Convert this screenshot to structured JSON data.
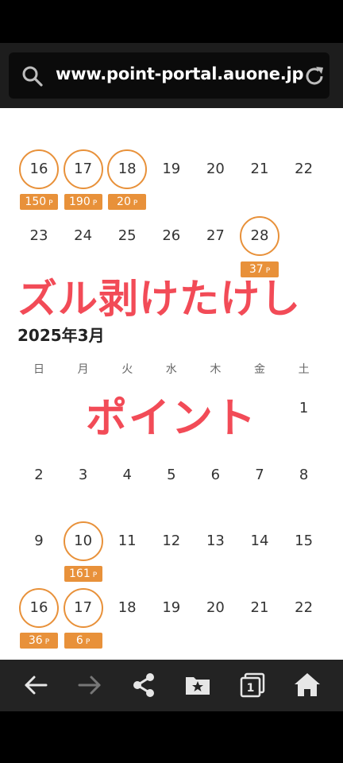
{
  "browser": {
    "url": "www.point-portal.auone.jp"
  },
  "calendar_feb": {
    "rows": [
      [
        {
          "day": "16",
          "points": "150",
          "unit": "P",
          "circled": true
        },
        {
          "day": "17",
          "points": "190",
          "unit": "P",
          "circled": true
        },
        {
          "day": "18",
          "points": "20",
          "unit": "P",
          "circled": true
        },
        {
          "day": "19"
        },
        {
          "day": "20"
        },
        {
          "day": "21"
        },
        {
          "day": "22"
        }
      ],
      [
        {
          "day": "23"
        },
        {
          "day": "24"
        },
        {
          "day": "25"
        },
        {
          "day": "26"
        },
        {
          "day": "27"
        },
        {
          "day": "28",
          "points": "37",
          "unit": "P",
          "circled": true
        }
      ]
    ]
  },
  "overlay_text": {
    "headline": "ズル剥けたけし",
    "subline": "ポイント"
  },
  "calendar_mar": {
    "title": "2025年3月",
    "weekdays": [
      "日",
      "月",
      "火",
      "水",
      "木",
      "金",
      "土"
    ],
    "rows": [
      [
        {
          "day": "1"
        }
      ],
      [
        {
          "day": "2"
        },
        {
          "day": "3"
        },
        {
          "day": "4"
        },
        {
          "day": "5"
        },
        {
          "day": "6"
        },
        {
          "day": "7"
        },
        {
          "day": "8"
        }
      ],
      [
        {
          "day": "9"
        },
        {
          "day": "10",
          "points": "161",
          "unit": "P",
          "circled": true
        },
        {
          "day": "11"
        },
        {
          "day": "12"
        },
        {
          "day": "13"
        },
        {
          "day": "14"
        },
        {
          "day": "15"
        }
      ],
      [
        {
          "day": "16",
          "points": "36",
          "unit": "P",
          "circled": true
        },
        {
          "day": "17",
          "points": "6",
          "unit": "P",
          "circled": true
        },
        {
          "day": "18"
        },
        {
          "day": "19"
        },
        {
          "day": "20"
        },
        {
          "day": "21"
        },
        {
          "day": "22"
        }
      ]
    ]
  },
  "navbar": {
    "items": [
      "back-icon",
      "forward-icon",
      "share-icon",
      "bookmarks-icon",
      "tabs-icon",
      "home-icon"
    ],
    "tab_count": "1"
  }
}
